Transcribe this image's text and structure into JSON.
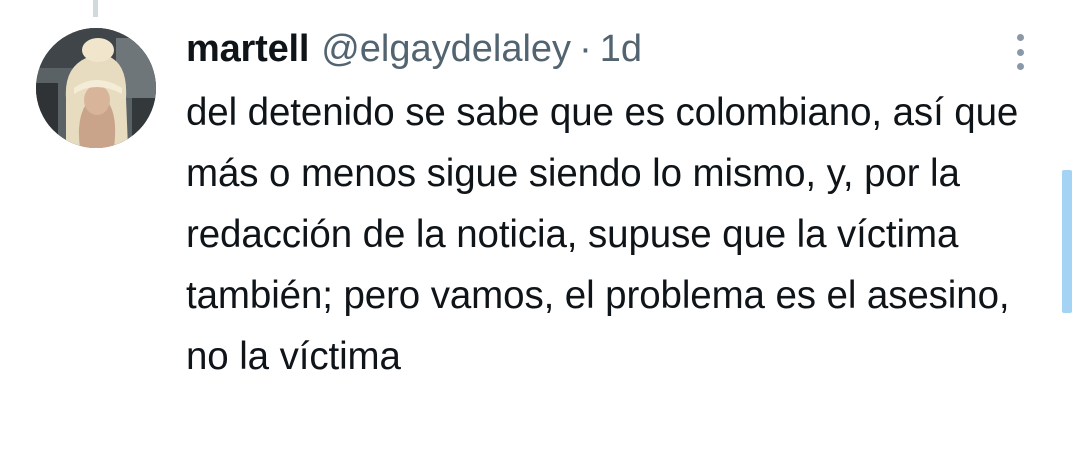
{
  "tweet": {
    "display_name": "martell",
    "handle": "@elgaydelaley",
    "separator": "·",
    "time": "1d",
    "text": "del detenido se sabe que es colombiano, así que más o menos sigue siendo lo mismo, y, por la redacción de la noticia, supuse que la víctima también; pero vamos, el problema es el asesino, no la víctima"
  },
  "icons": {
    "more": "more-vertical-icon",
    "avatar": "avatar-image"
  },
  "colors": {
    "text_primary": "#0f1419",
    "text_secondary": "#536471",
    "thread_line": "#cfd9de",
    "scrollbar": "#a5d3f4"
  }
}
